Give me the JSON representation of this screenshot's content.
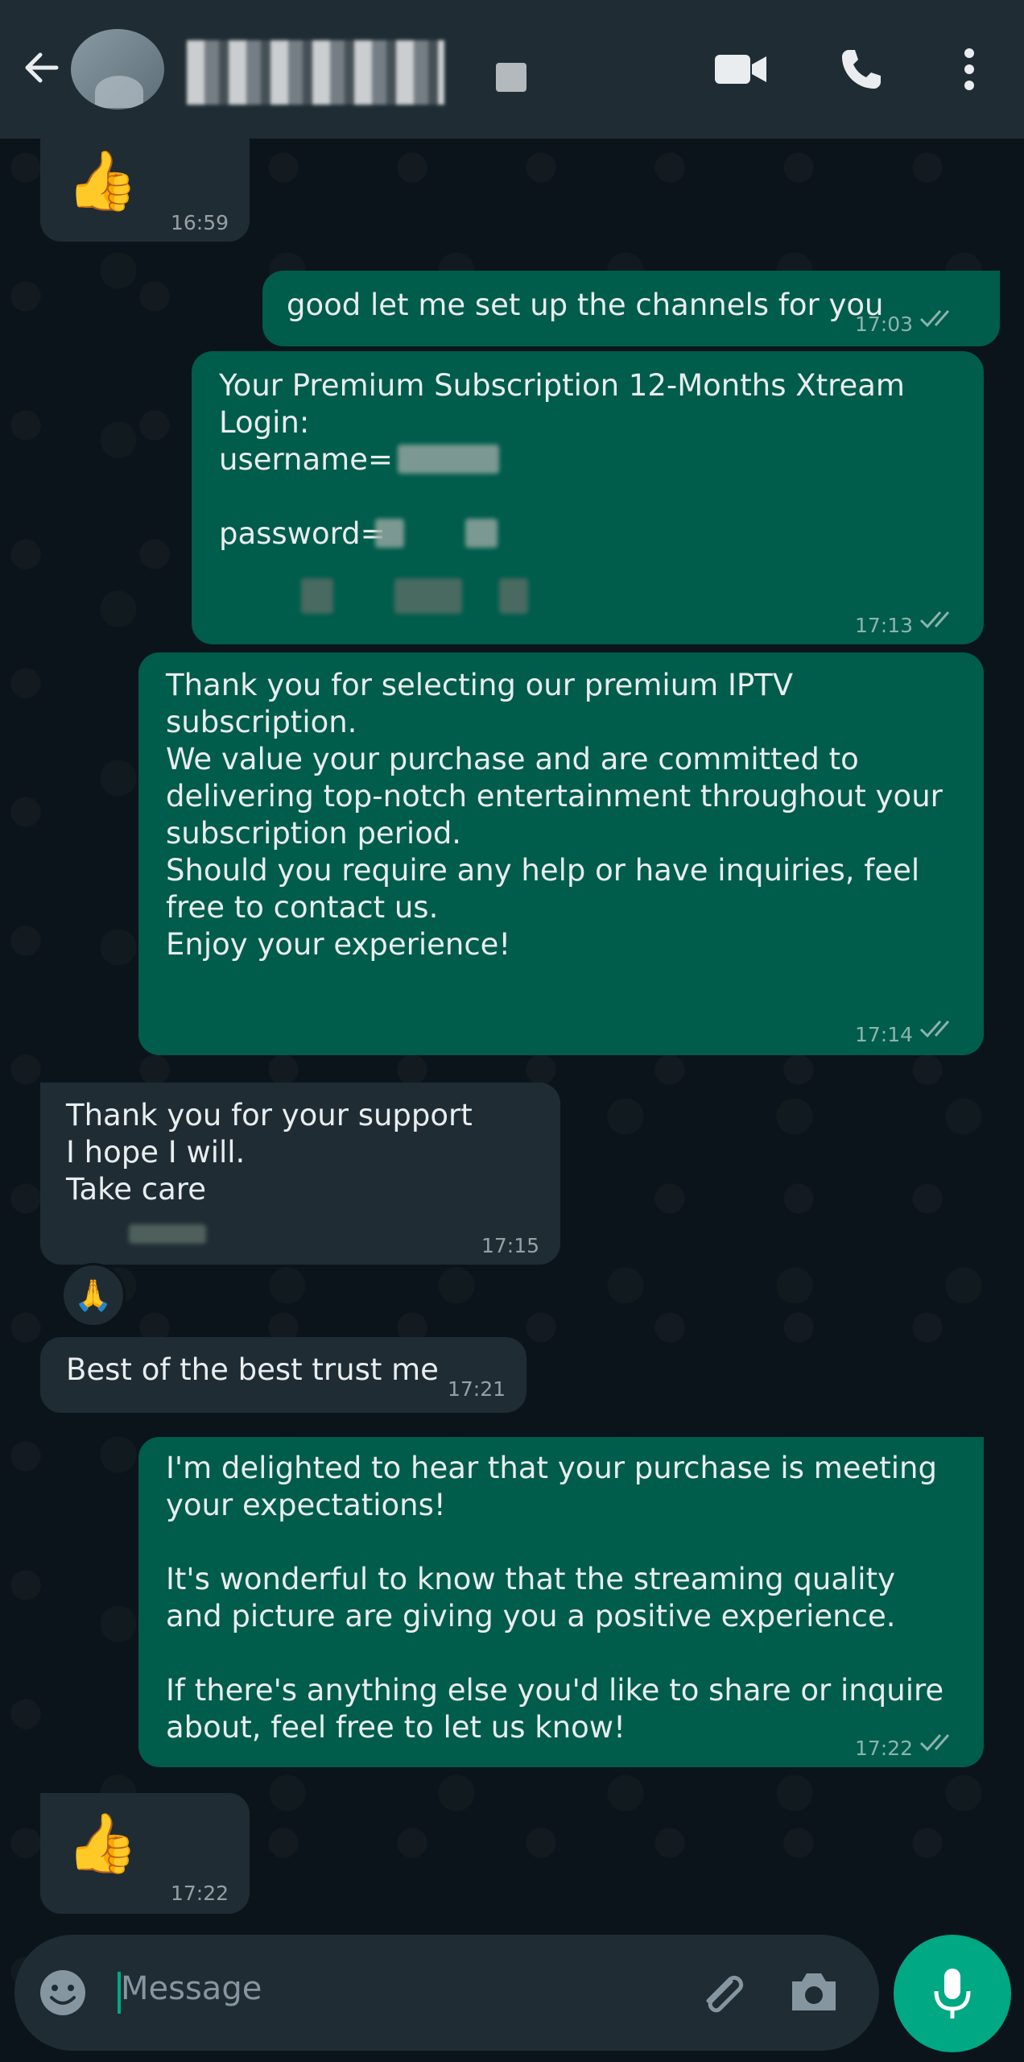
{
  "header": {
    "contact_name": "",
    "icons": [
      "back-arrow-icon",
      "avatar",
      "video-call-icon",
      "voice-call-icon",
      "more-options-icon"
    ]
  },
  "messages": [
    {
      "id": "m1",
      "direction": "incoming",
      "content": "👍",
      "time": "16:59"
    },
    {
      "id": "m2",
      "direction": "outgoing",
      "text": "good let me set up the channels for you",
      "time": "17:03",
      "status": "read"
    },
    {
      "id": "m3",
      "direction": "outgoing",
      "line1": "Your Premium Subscription 12-Months Xtream Login:",
      "line2": "username=",
      "line3": "password=",
      "time": "17:13",
      "status": "read"
    },
    {
      "id": "m4",
      "direction": "outgoing",
      "p1": "Thank you for selecting our premium IPTV subscription.",
      "p2": " We value your purchase and are committed to delivering top-notch entertainment throughout your subscription period.",
      "p3": "Should you require any help or have inquiries, feel free to contact us.",
      "p4": "Enjoy your experience!",
      "time": "17:14",
      "status": "read"
    },
    {
      "id": "m5",
      "direction": "incoming",
      "text": "Thank you for your support\nI hope I will.\nTake care",
      "time": "17:15",
      "reaction": "🙏"
    },
    {
      "id": "m6",
      "direction": "incoming",
      "text": "Best of the best trust me",
      "time": "17:21"
    },
    {
      "id": "m7",
      "direction": "outgoing",
      "p1": "I'm delighted to hear that your purchase is meeting your expectations!",
      "p2": "It's wonderful to know that the streaming quality and picture are giving you a positive experience.",
      "p3": "If there's anything else you'd like to share or inquire about, feel free to let us know!",
      "time": "17:22",
      "status": "read"
    },
    {
      "id": "m8",
      "direction": "incoming",
      "content": "👍",
      "time": "17:22"
    }
  ],
  "input": {
    "placeholder": "Message",
    "icons": [
      "emoji-icon",
      "attach-icon",
      "camera-icon",
      "mic-icon"
    ]
  },
  "colors": {
    "background": "#0b141a",
    "header": "#1f2c34",
    "incoming_bubble": "#1f2c34",
    "outgoing_bubble": "#005c4b",
    "accent": "#00a884"
  }
}
